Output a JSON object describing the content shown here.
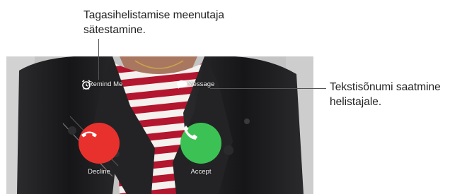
{
  "callouts": {
    "remind_line1": "Tagasihelistamise meenutaja",
    "remind_line2": "sätestamine.",
    "message_line1": "Tekstisõnumi saatmine",
    "message_line2": "helistajale."
  },
  "actions": {
    "remind_label": "Remind Me",
    "message_label": "Message",
    "decline_label": "Decline",
    "accept_label": "Accept"
  },
  "colors": {
    "decline": "#e8312d",
    "accept": "#3cc254",
    "jacket": "#1c1c1e",
    "stripe_red": "#b3162e"
  },
  "icons": {
    "remind": "alarm-clock-icon",
    "message": "speech-bubble-icon",
    "decline": "phone-hangup-icon",
    "accept": "phone-icon"
  }
}
